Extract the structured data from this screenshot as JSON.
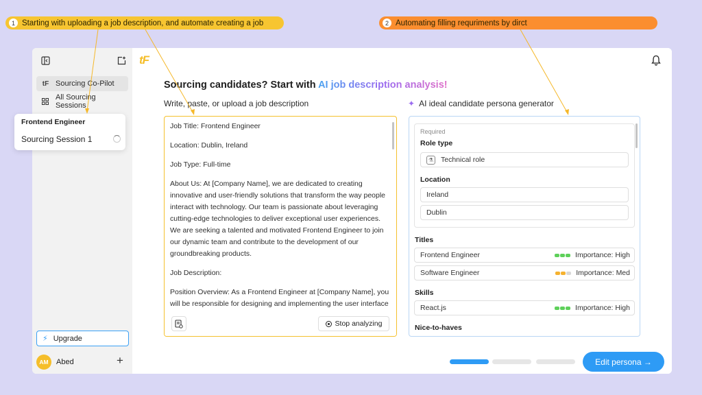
{
  "annotations": {
    "step1": {
      "num": "1",
      "text": "Starting with uploading a job description, and automate creating a job"
    },
    "step2": {
      "num": "2",
      "text": "Automating filling requriments by dirct"
    }
  },
  "sidebar": {
    "items": [
      {
        "label": "Sourcing Co-Pilot",
        "icon": "tf-logo-icon"
      },
      {
        "label": "All Sourcing Sessions",
        "icon": "grid-icon"
      }
    ],
    "upgrade_label": "Upgrade",
    "user": {
      "initials": "AM",
      "name": "Abed"
    }
  },
  "popover": {
    "title": "Frontend Engineer",
    "session": "Sourcing Session 1"
  },
  "main": {
    "logo": "tF",
    "headline_plain": "Sourcing candidates? Start with ",
    "headline_accent": "AI job description analysis!",
    "left_subtitle": "Write, paste, or upload a job description",
    "right_subtitle": "AI ideal candidate persona generator",
    "job_description": [
      "Job Title: Frontend Engineer",
      "Location: Dublin, Ireland",
      "Job Type: Full-time",
      "About Us: At [Company Name], we are dedicated to creating innovative and user-friendly solutions that transform the way people interact with technology. Our team is passionate about leveraging cutting-edge technologies to deliver exceptional user experiences. We are seeking a talented and motivated Frontend Engineer to join our dynamic team and contribute to the development of our groundbreaking products.",
      "Job Description:",
      "Position Overview: As a Frontend Engineer at [Company Name], you will be responsible for designing and implementing the user interface"
    ],
    "stop_label": "Stop analyzing",
    "persona": {
      "required_label": "Required",
      "role_type_label": "Role type",
      "role_type_value": "Technical role",
      "location_label": "Location",
      "locations": [
        "Ireland",
        "Dublin"
      ],
      "titles_label": "Titles",
      "titles": [
        {
          "name": "Frontend Engineer",
          "importance": "Importance: High",
          "level": "high"
        },
        {
          "name": "Software Engineer",
          "importance": "Importance: Med",
          "level": "med"
        }
      ],
      "skills_label": "Skills",
      "skills": [
        {
          "name": "React.js",
          "importance": "Importance: High",
          "level": "high"
        }
      ],
      "nice_label": "Nice-to-haves"
    },
    "progress": {
      "steps": 3,
      "current": 1
    },
    "edit_button": "Edit persona →"
  },
  "colors": {
    "accent": "#2e9bf5",
    "brand": "#f5be2a",
    "annotation1": "#f7c531",
    "annotation2": "#fb8e2f",
    "background": "#d9d7f5"
  }
}
